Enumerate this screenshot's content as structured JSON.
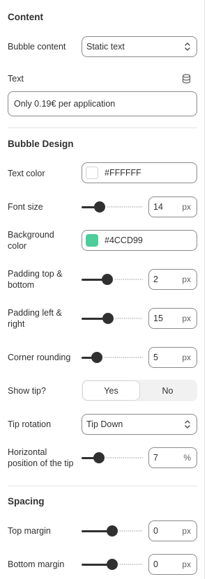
{
  "sections": {
    "content": "Content",
    "bubble_design": "Bubble Design",
    "spacing": "Spacing"
  },
  "bubble_content": {
    "label": "Bubble content",
    "value": "Static text"
  },
  "text": {
    "label": "Text",
    "value": "Only 0.19€ per application"
  },
  "text_color": {
    "label": "Text color",
    "value": "#FFFFFF",
    "swatch": "#FFFFFF"
  },
  "font_size": {
    "label": "Font size",
    "value": "14",
    "unit": "px",
    "slider_fraction": 0.3
  },
  "background_color": {
    "label_line1": "Background",
    "label_line2": "color",
    "value": "#4CCD99",
    "swatch": "#4CCD99"
  },
  "padding_top_bottom": {
    "label_line1": "Padding top &",
    "label_line2": "bottom",
    "value": "2",
    "unit": "px",
    "slider_fraction": 0.42
  },
  "padding_left_right": {
    "label_line1": "Padding left &",
    "label_line2": "right",
    "value": "15",
    "unit": "px",
    "slider_fraction": 0.43
  },
  "corner_rounding": {
    "label": "Corner rounding",
    "value": "5",
    "unit": "px",
    "slider_fraction": 0.25
  },
  "show_tip": {
    "label": "Show tip?",
    "options": [
      "Yes",
      "No"
    ],
    "selected": "Yes"
  },
  "tip_rotation": {
    "label": "Tip rotation",
    "value": "Tip Down"
  },
  "horizontal_tip": {
    "label_line1": "Horizontal",
    "label_line2": "position of the tip",
    "value": "7",
    "unit": "%",
    "slider_fraction": 0.28
  },
  "top_margin": {
    "label": "Top margin",
    "value": "0",
    "unit": "px",
    "slider_fraction": 0.5
  },
  "bottom_margin": {
    "label": "Bottom margin",
    "value": "0",
    "unit": "px",
    "slider_fraction": 0.5
  },
  "icons": {
    "database": "database-icon",
    "chevron": "select-chevron-icon"
  }
}
